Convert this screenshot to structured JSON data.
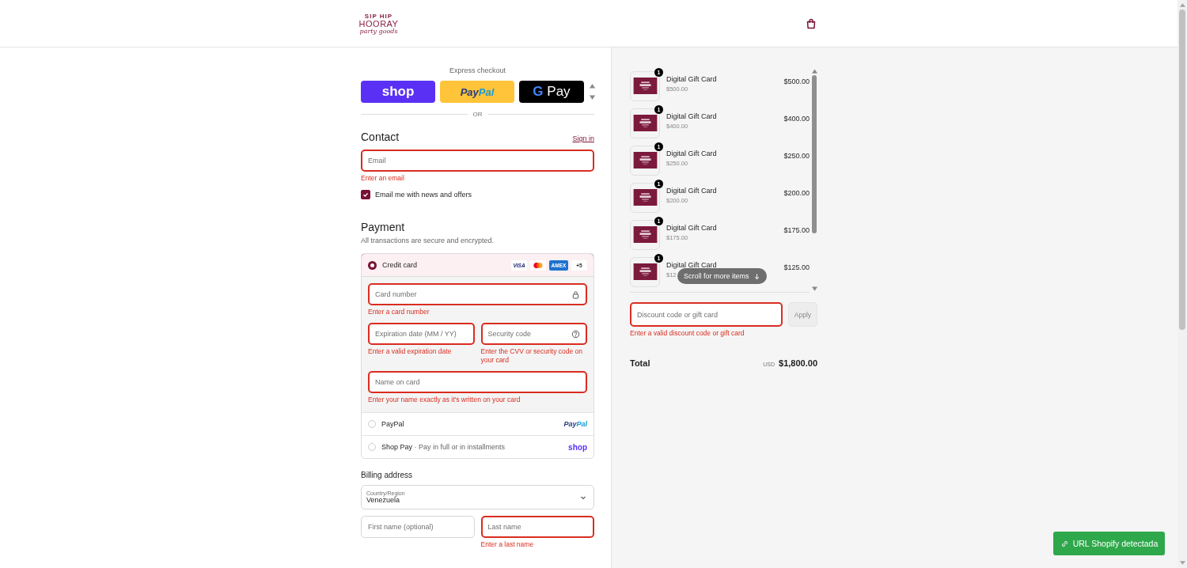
{
  "header": {
    "logo": {
      "line_1": "SIP HIP",
      "line_2": "HOORAY",
      "line_3": "party goods"
    }
  },
  "express_checkout": {
    "title": "Express checkout",
    "buttons": [
      {
        "kind": "shop",
        "label": "shop"
      },
      {
        "kind": "paypal",
        "label": "Pay",
        "label_2": "Pal"
      },
      {
        "kind": "gpay",
        "logo": "G",
        "label": "Pay"
      }
    ],
    "divider": "OR"
  },
  "contact": {
    "title": "Contact",
    "sign_in": "Sign in",
    "email": {
      "placeholder": "Email",
      "invalid": true,
      "error": "Enter an email"
    },
    "newsletter": {
      "label": "Email me with news and offers",
      "checked": true
    }
  },
  "payment": {
    "title": "Payment",
    "subtitle": "All transactions are secure and encrypted.",
    "methods": [
      {
        "kind": "card",
        "label": "Credit card",
        "selected": true,
        "brands": [
          {
            "kind": "visa",
            "label": "VISA"
          },
          {
            "kind": "mastercard"
          },
          {
            "kind": "amex",
            "label": "AMEX"
          },
          {
            "kind": "more",
            "label": "+5"
          }
        ],
        "field_rows": [
          [
            {
              "kind": "secure",
              "placeholder": "Card number",
              "invalid": true,
              "error": "Enter a card number"
            }
          ],
          [
            {
              "placeholder": "Expiration date (MM / YY)",
              "invalid": true,
              "error": "Enter a valid expiration date"
            },
            {
              "kind": "help",
              "placeholder": "Security code",
              "invalid": true,
              "error": "Enter the CVV or security code on your card"
            }
          ],
          [
            {
              "placeholder": "Name on card",
              "invalid": true,
              "error": "Enter your name exactly as it's written on your card"
            }
          ]
        ]
      },
      {
        "kind": "paypal",
        "label": "PayPal",
        "selected": false,
        "logo": "Pay",
        "logo_2": "Pal"
      },
      {
        "kind": "shoppay",
        "label": "Shop Pay",
        "selected": false,
        "separator": "·",
        "note": "Pay in full or in installments",
        "logo": "shop"
      }
    ]
  },
  "billing": {
    "title": "Billing address",
    "country": {
      "label": "Country/Region",
      "value": "Venezuela"
    },
    "fields": [
      {
        "placeholder": "First name (optional)",
        "invalid": false
      },
      {
        "placeholder": "Last name",
        "invalid": true,
        "error": "Enter a last name"
      }
    ]
  },
  "order": {
    "items": [
      {
        "name": "Digital Gift Card",
        "sub": "$500.00",
        "price": "$500.00",
        "quantity": "1"
      },
      {
        "name": "Digital Gift Card",
        "sub": "$400.00",
        "price": "$400.00",
        "quantity": "1"
      },
      {
        "name": "Digital Gift Card",
        "sub": "$250.00",
        "price": "$250.00",
        "quantity": "1"
      },
      {
        "name": "Digital Gift Card",
        "sub": "$200.00",
        "price": "$200.00",
        "quantity": "1"
      },
      {
        "name": "Digital Gift Card",
        "sub": "$175.00",
        "price": "$175.00",
        "quantity": "1"
      },
      {
        "name": "Digital Gift Card",
        "sub": "$12",
        "price": "$125.00",
        "quantity": "1"
      }
    ],
    "scroll_hint": "Scroll for more items",
    "discount": {
      "placeholder": "Discount code or gift card",
      "invalid": true,
      "error": "Enter a valid discount code or gift card",
      "apply": "Apply",
      "apply_disabled": true
    },
    "total": {
      "label": "Total",
      "currency": "USD",
      "amount": "$1,800.00"
    }
  },
  "toast": {
    "label": "URL Shopify detectada"
  }
}
